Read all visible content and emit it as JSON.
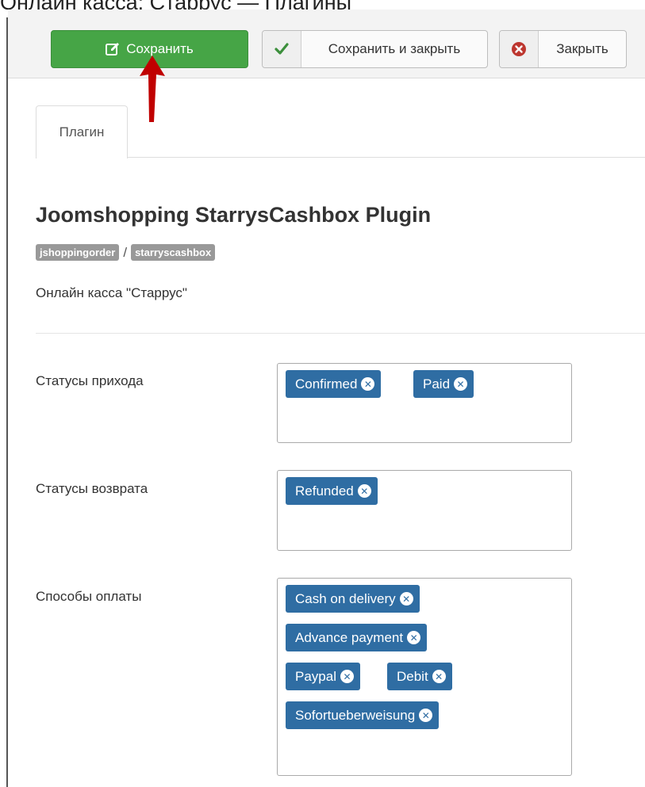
{
  "window_title": "Онлайн касса: Старрус — Плагины",
  "toolbar": {
    "save_label": "Сохранить",
    "save_close_label": "Сохранить и закрыть",
    "close_label": "Закрыть"
  },
  "tabs": [
    {
      "label": "Плагин"
    }
  ],
  "plugin": {
    "title": "Joomshopping StarrysCashbox Plugin",
    "group": "jshoppingorder",
    "separator": "/",
    "element": "starryscashbox",
    "description": "Онлайн касса \"Старрус\""
  },
  "fields": {
    "income": {
      "label": "Статусы прихода",
      "tags": [
        "Confirmed",
        "Paid"
      ]
    },
    "refund": {
      "label": "Статусы возврата",
      "tags": [
        "Refunded"
      ]
    },
    "payment": {
      "label": "Способы оплаты",
      "tags": [
        "Cash on delivery",
        "Advance payment",
        "Paypal",
        "Debit",
        "Sofortueberweisung"
      ]
    }
  },
  "icons": {
    "save": "edit-icon",
    "save_close": "check-icon",
    "close": "close-circle-icon",
    "annotation": "red-arrow"
  },
  "colors": {
    "save_button": "#46a546",
    "chip": "#2f6da3",
    "badge": "#999999",
    "close_icon": "#bd362f",
    "check_icon": "#3c8f3c",
    "arrow": "#c00000"
  }
}
